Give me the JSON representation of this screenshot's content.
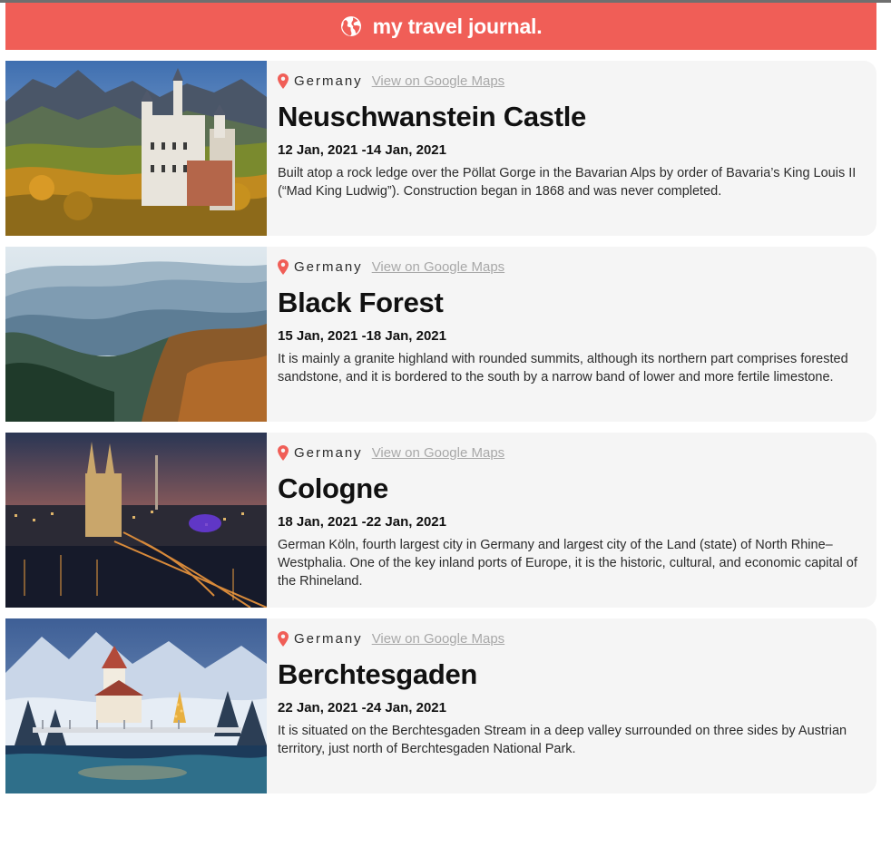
{
  "header": {
    "title": "my travel journal.",
    "icon": "globe-icon",
    "background": "#f05e57"
  },
  "entries": [
    {
      "country": "Germany",
      "map_link": "View on Google Maps",
      "place": "Neuschwanstein Castle",
      "dates": "12 Jan, 2021 -14 Jan, 2021",
      "description": "Built atop a rock ledge over the Pöllat Gorge in the Bavarian Alps by order of Bavaria’s King Louis II (“Mad King Ludwig”). Construction began in 1868 and was never completed."
    },
    {
      "country": "Germany",
      "map_link": "View on Google Maps",
      "place": "Black Forest",
      "dates": "15 Jan, 2021 -18 Jan, 2021",
      "description": "It is mainly a granite highland with rounded summits, although its northern part comprises forested sandstone, and it is bordered to the south by a narrow band of lower and more fertile limestone."
    },
    {
      "country": "Germany",
      "map_link": "View on Google Maps",
      "place": "Cologne",
      "dates": "18 Jan, 2021 -22 Jan, 2021",
      "description": "German Köln, fourth largest city in Germany and largest city of the Land (state) of North Rhine–Westphalia. One of the key inland ports of Europe, it is the historic, cultural, and economic capital of the Rhineland."
    },
    {
      "country": "Germany",
      "map_link": "View on Google Maps",
      "place": "Berchtesgaden",
      "dates": "22 Jan, 2021 -24 Jan, 2021",
      "description": "It is situated on the Berchtesgaden Stream in a deep valley surrounded on three sides by Austrian territory, just north of Berchtesgaden National Park."
    }
  ],
  "colors": {
    "accent": "#f05e57",
    "card_bg": "#f5f5f5",
    "link": "#a8a8a8"
  }
}
